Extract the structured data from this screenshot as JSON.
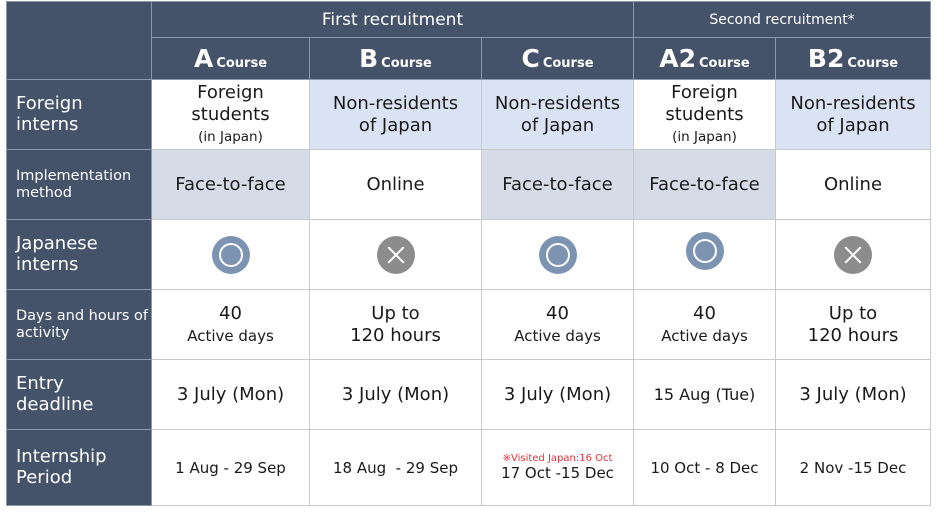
{
  "header": {
    "first_recruitment": "First recruitment",
    "second_recruitment": "Second recruitment*",
    "course_word": "Course",
    "courses": [
      {
        "letter": "A"
      },
      {
        "letter": "B"
      },
      {
        "letter": "C"
      },
      {
        "letter": "A2"
      },
      {
        "letter": "B2"
      }
    ]
  },
  "rows": {
    "foreign_interns": {
      "label": "Foreign interns",
      "values": [
        {
          "line1": "Foreign",
          "line2": "students",
          "sub": "(in Japan)"
        },
        {
          "line1": "Non-residents",
          "line2": "of Japan"
        },
        {
          "line1": "Non-residents",
          "line2": "of Japan"
        },
        {
          "line1": "Foreign",
          "line2": "students",
          "sub": "(in Japan)"
        },
        {
          "line1": "Non-residents",
          "line2": "of Japan"
        }
      ]
    },
    "implementation_method": {
      "label": "Implementation method",
      "values": [
        "Face-to-face",
        "Online",
        "Face-to-face",
        "Face-to-face",
        "Online"
      ]
    },
    "japanese_interns": {
      "label": "Japanese interns",
      "values": [
        "yes",
        "no",
        "yes",
        "yes",
        "no"
      ],
      "icons": {
        "yes": "double-circle-icon",
        "no": "cross-circle-icon"
      }
    },
    "days_hours": {
      "label": "Days and hours of activity",
      "values": [
        {
          "top": "40",
          "bottom": "Active days"
        },
        {
          "top": "Up to",
          "bottom": "120 hours"
        },
        {
          "top": "40",
          "bottom": "Active days"
        },
        {
          "top": "40",
          "bottom": "Active days"
        },
        {
          "top": "Up to",
          "bottom": "120 hours"
        }
      ]
    },
    "entry_deadline": {
      "label": "Entry deadline",
      "values": [
        "3 July (Mon)",
        "3 July (Mon)",
        "3 July (Mon)",
        "15 Aug (Tue)",
        "3 July (Mon)"
      ]
    },
    "internship_period": {
      "label": "Internship Period",
      "values": [
        "1 Aug - 29 Sep",
        "18 Aug  - 29 Sep",
        "17 Oct -15 Dec",
        "10 Oct - 8 Dec",
        "2 Nov -15 Dec"
      ],
      "notes": [
        "",
        "",
        "※Visited Japan:16 Oct",
        "",
        ""
      ]
    }
  },
  "colors": {
    "header_bg": "#445369",
    "shaded_cell": "#d5dce7",
    "blue_cell": "#dae3f3",
    "yes_icon": "#7d93b2",
    "no_icon": "#8c8c8c",
    "note_red": "#e8303a"
  }
}
